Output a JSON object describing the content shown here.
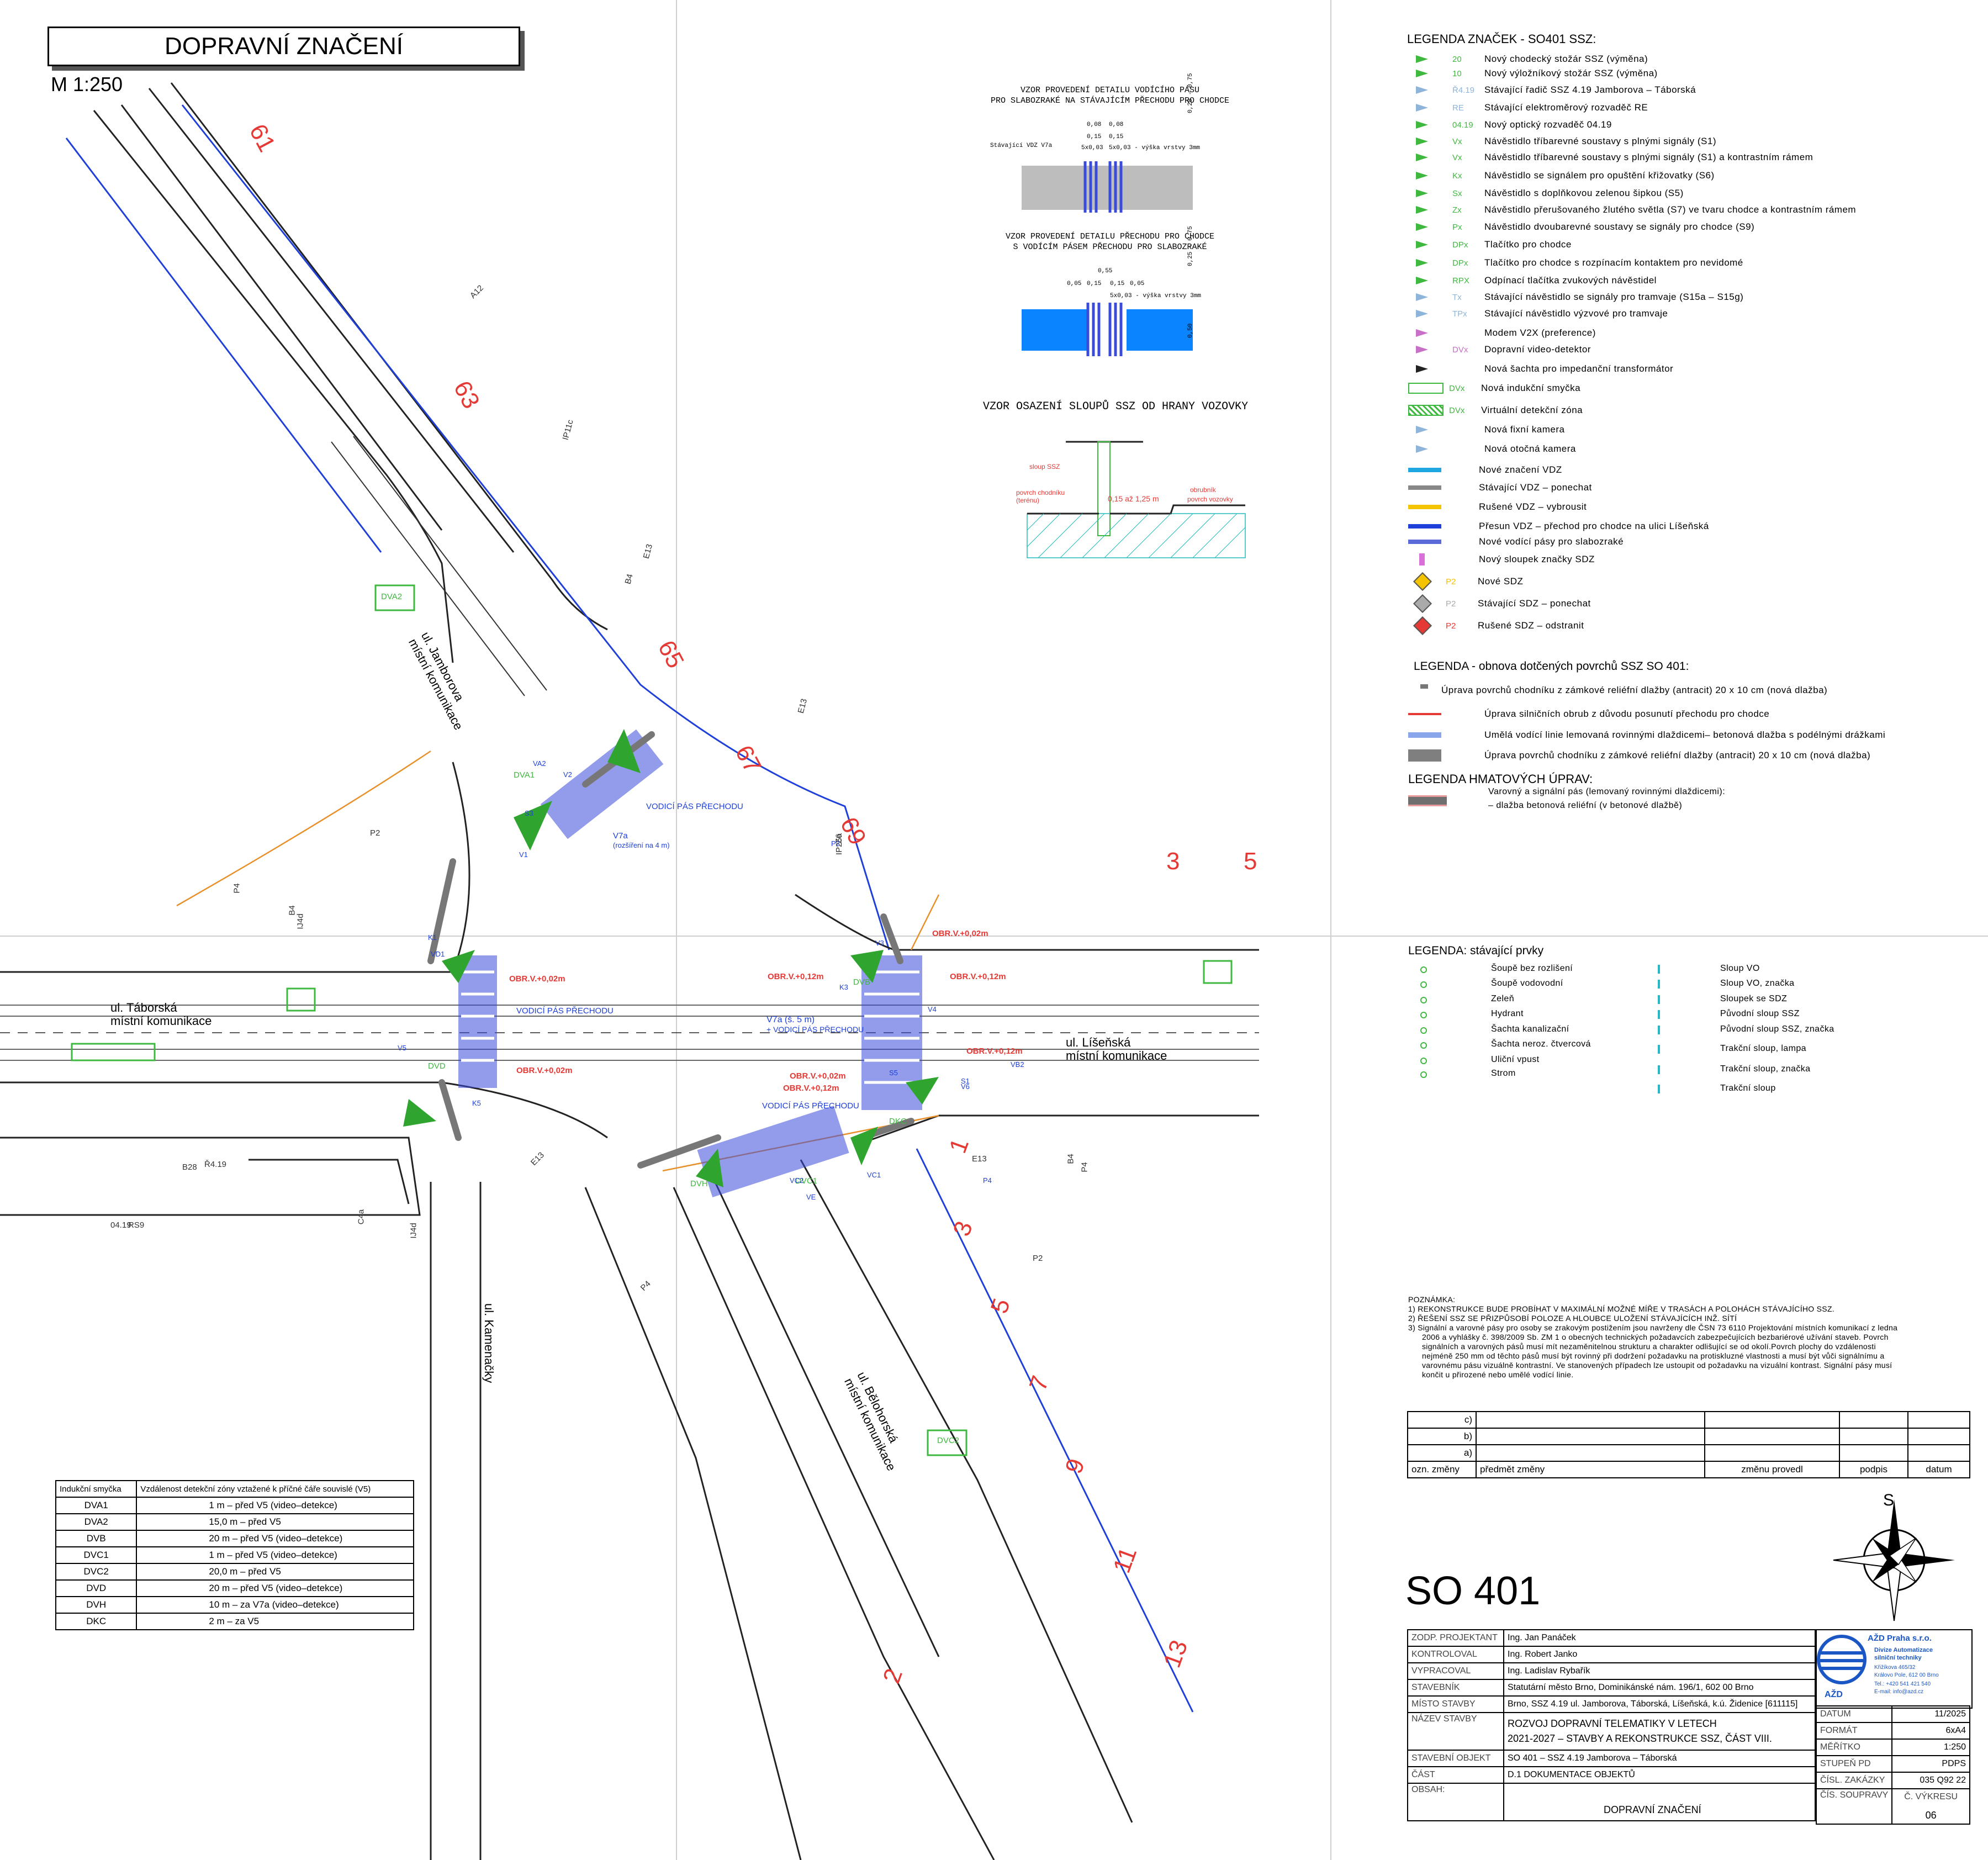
{
  "header": {
    "title": "DOPRAVNÍ ZNAČENÍ",
    "scale": "M 1:250"
  },
  "details": {
    "d1_title_1": "VZOR PROVEDENÍ DETAILU VODÍCÍHO PÁSU",
    "d1_title_2": "PRO SLABOZRAKÉ NA STÁVAJÍCÍM PŘECHODU PRO CHODCE",
    "d1_label": "Stávající VDZ V7a",
    "d1_dim1": "0,08",
    "d1_dim2": "0,15",
    "d1_dim3": "5x0,03",
    "d1_dim4": "5x0,03 - výška vrstvy 3mm",
    "d1_dim5": "0,25 - 0,75",
    "d2_title_1": "VZOR PROVEDENÍ DETAILU PŘECHODU PRO CHODCE",
    "d2_title_2": "S VODÍCÍM PÁSEM PŘECHODU PRO SLABOZRAKÉ",
    "d2_dim1": "0,55",
    "d2_dim2": "0,05",
    "d2_dim3": "0,15",
    "d2_dim4": "5x0,03 - výška vrstvy 3mm",
    "d2_dim5": "0,25 - 0,75",
    "d2_dim6": "0,50",
    "d3_title": "VZOR OSAZENÍ SLOUPŮ SSZ OD HRANY VOZOVKY",
    "d3_l1": "sloup SSZ",
    "d3_l2": "povrch chodníku (terénu)",
    "d3_l3": "0,15 až 1,25 m",
    "d3_l4": "obrubník",
    "d3_l5": "povrch vozovky"
  },
  "legend_ssz": {
    "title": "LEGENDA ZNAČEK -  SO401 SSZ:",
    "items": [
      {
        "code": "20",
        "text": "Nový chodecký stožár SSZ (výměna)",
        "color": "#3fb83f"
      },
      {
        "code": "10",
        "text": "Nový výložníkový stožár SSZ (výměna)",
        "color": "#3fb83f"
      },
      {
        "code": "Ř4.19",
        "text": "Stávající řadič SSZ 4.19 Jamborova – Táborská",
        "color": "#8fb4d9"
      },
      {
        "code": "RE",
        "text": "Stávající elektroměrový rozvaděč RE",
        "color": "#8fb4d9"
      },
      {
        "code": "04.19",
        "text": "Nový optický rozvaděč 04.19",
        "color": "#3fb83f"
      },
      {
        "code": "Vx",
        "text": "Návěstidlo tříbarevné soustavy s plnými signály (S1)",
        "color": "#3fb83f"
      },
      {
        "code": "Vx",
        "text": "Návěstidlo tříbarevné soustavy s plnými signály (S1) a kontrastním rámem",
        "color": "#3fb83f"
      },
      {
        "code": "Kx",
        "text": "Návěstidlo se signálem pro opuštění křižovatky (S6)",
        "color": "#3fb83f"
      },
      {
        "code": "Sx",
        "text": "Návěstidlo s doplňkovou zelenou šipkou (S5)",
        "color": "#3fb83f"
      },
      {
        "code": "Zx",
        "text": "Návěstidlo přerušovaného žlutého světla (S7) ve tvaru chodce a kontrastním rámem",
        "color": "#3fb83f"
      },
      {
        "code": "Px",
        "text": "Návěstidlo dvoubarevné soustavy se signály pro chodce (S9)",
        "color": "#3fb83f"
      },
      {
        "code": "DPx",
        "text": "Tlačítko pro chodce",
        "color": "#3fb83f"
      },
      {
        "code": "DPx",
        "text": "Tlačítko pro chodce s rozpínacím kontaktem pro nevidomé",
        "color": "#3fb83f"
      },
      {
        "code": "RPX",
        "text": "Odpínací tlačítka zvukových návěstidel",
        "color": "#3fb83f"
      },
      {
        "code": "Tx",
        "text": "Stávající návěstidlo se signály pro tramvaje (S15a – S15g)",
        "color": "#8fb4d9"
      },
      {
        "code": "TPx",
        "text": "Stávající návěstidlo výzvové pro tramvaje",
        "color": "#8fb4d9"
      },
      {
        "code": "",
        "text": "Modem V2X (preference)",
        "color": "#c86fc8"
      },
      {
        "code": "DVx",
        "text": "Dopravní video-detektor",
        "color": "#c86fc8"
      },
      {
        "code": "",
        "text": "Nová šachta pro impedanční transformátor",
        "color": "#222222"
      },
      {
        "code": "DVx",
        "text": "Nová indukční smyčka",
        "color": "#3fb83f"
      },
      {
        "code": "DVx",
        "text": "Virtuální detekční zóna",
        "color": "#3fb83f"
      },
      {
        "code": "",
        "text": "Nová fixní kamera",
        "color": "#8fb4d9"
      },
      {
        "code": "",
        "text": "Nová otočná kamera",
        "color": "#8fb4d9"
      },
      {
        "code": "",
        "text": "Nové značení VDZ",
        "color": "#1ea7e1"
      },
      {
        "code": "",
        "text": "Stávající VDZ – ponechat",
        "color": "#888888"
      },
      {
        "code": "",
        "text": "Rušené VDZ – vybrousit",
        "color": "#f5c400"
      },
      {
        "code": "",
        "text": "Přesun VDZ – přechod pro chodce na ulici Líšeňská",
        "color": "#1e40d9"
      },
      {
        "code": "",
        "text": "Nové vodící pásy pro slabozraké",
        "color": "#5a6bd9"
      },
      {
        "code": "",
        "text": "Nový sloupek značky SDZ",
        "color": "#d96fd9"
      },
      {
        "code": "P2",
        "text": "Nové SDZ",
        "color": "#f5c400"
      },
      {
        "code": "P2",
        "text": "Stávající SDZ – ponechat",
        "color": "#aaaaaa"
      },
      {
        "code": "P2",
        "text": "Rušené SDZ – odstranit",
        "color": "#e53935"
      }
    ]
  },
  "legend_surface": {
    "title": "LEGENDA - obnova dotčených povrchů SSZ SO 401:",
    "items": [
      "Úprava povrchů chodníku z zámkové reliéfní dlažby  (antracit) 20 x 10 cm (nová dlažba)",
      "Úprava silničních obrub z důvodu posunutí přechodu pro chodce",
      "Umělá vodící linie lemovaná rovinnými dlaždicemi– betonová dlažba s podélnými drážkami",
      "Úprava povrchů chodníku z zámkové reliéfní dlažby  (antracit) 20 x 10 cm (nová dlažba)"
    ]
  },
  "legend_tactile": {
    "title": "LEGENDA HMATOVÝCH ÚPRAV:",
    "line1": "Varovný a signální pás (lemovaný rovinnými dlaždicemi):",
    "line2": "– dlažba betonová reliéfní (v betonové dlažbě)"
  },
  "legend_existing": {
    "title": "LEGENDA: stávající prvky",
    "left": [
      "Šoupě bez rozlišení",
      "Šoupě vodovodní",
      "Zeleň",
      "Hydrant",
      "Šachta kanalizační",
      "Šachta neroz. čtvercová",
      "Uliční vpust",
      "Strom"
    ],
    "right": [
      "Sloup VO",
      "Sloup VO, značka",
      "Sloupek se SDZ",
      "Původní sloup SSZ",
      "Původní sloup SSZ, značka",
      "Trakční sloup, lampa",
      "Trakční sloup, značka",
      "Trakční sloup"
    ]
  },
  "notes": {
    "title": "POZNÁMKA:",
    "n1": "1)   REKONSTRUKCE BUDE PROBÍHAT V MAXIMÁLNÍ MOŽNÉ MÍŘE V TRASÁCH A POLOHÁCH STÁVAJÍCÍHO SSZ.",
    "n2": "2)   ŘEŠENÍ SSZ SE PŘIZPŮSOBÍ POLOZE A HLOUBCE  ULOŽENÍ STÁVAJÍCÍCH INŽ. SÍTÍ",
    "n3a": "3)   Signální a varovné pásy pro osoby se zrakovým postižením jsou navrženy dle ČSN 73 6110 Projektování místních komunikací z ledna",
    "n3b": "2006 a vyhlášky č. 398/2009 Sb. ZM 1 o obecných technických požadavcích zabezpečujících bezbariérové užívání staveb. Povrch",
    "n3c": "signálních a varovných pásů musí mít nezaměnitelnou   strukturu a charakter odlišující se od okolí.Povrch plochy do   vzdálenosti",
    "n3d": "nejméně 250 mm od těchto pásů musí být rovinný při dodržení požadavku na protiskluzné vlastnosti a musí být vůči signálnímu a",
    "n3e": "varovnému pásu vizuálně kontrastní. Ve stanovených případech lze ustoupit od požadavku na vizuální kontrast. Signální pásy musí",
    "n3f": "končit u přirozené nebo umělé vodící linie."
  },
  "changes": {
    "rows": [
      "c)",
      "b)",
      "a)"
    ],
    "h1": "ozn. změny",
    "h2": "předmět změny",
    "h3": "změnu provedl",
    "h4": "podpis",
    "h5": "datum"
  },
  "object_code": "SO 401",
  "compass_label": "S",
  "title_block": {
    "r1l": "ZODP. PROJEKTANT",
    "r1v": "Ing. Jan Panáček",
    "r2l": "KONTROLOVAL",
    "r2v": "Ing. Robert Janko",
    "r3l": "VYPRACOVAL",
    "r3v": "Ing. Ladislav Rybařík",
    "r4l": "STAVEBNÍK",
    "r4v": "Statutární město Brno, Dominikánské nám. 196/1, 602 00 Brno",
    "r5l": "MÍSTO STAVBY",
    "r5v": "Brno, SSZ 4.19 ul. Jamborova, Táborská, Líšeňská, k.ú. Židenice [611115]",
    "r6l": "NÁZEV STAVBY",
    "r6v1": "ROZVOJ DOPRAVNÍ TELEMATIKY V LETECH",
    "r6v2": "2021-2027 – STAVBY A REKONSTRUKCE SSZ, ČÁST VIII.",
    "r7l": "STAVEBNÍ OBJEKT",
    "r7v": "SO 401 – SSZ 4.19 Jamborova – Táborská",
    "r8l": "ČÁST",
    "r8v": "D.1 DOKUMENTACE OBJEKTŮ",
    "r9l": "OBSAH:",
    "r9v": "DOPRAVNÍ ZNAČENÍ",
    "company": "AŽD Praha s.r.o.",
    "division1": "Divize Automatizace",
    "division2": "silniční techniky",
    "addr1": "Křižíkova 465/32",
    "addr2": "Královo Pole, 612 00 Brno",
    "phone": "Tel.: +420 541 421 540",
    "email": "E-mail: info@azd.cz",
    "logo": "AŽD",
    "k1": "DATUM",
    "v1": "11/2025",
    "k2": "FORMÁT",
    "v2": "6xA4",
    "k3": "MĚŘÍTKO",
    "v3": "1:250",
    "k4": "STUPEŇ PD",
    "v4": "PDPS",
    "k5": "ČÍSL. ZAKÁZKY",
    "v5": "035 Q92 22",
    "k6": "ČÍS. SOUPRAVY",
    "k6b": "Č. VÝKRESU",
    "v6": "06"
  },
  "loops": {
    "h1": "Indukční smyčka",
    "h2": "Vzdálenost detekční zóny vztažené k příčné čáře souvislé (V5)",
    "rows": [
      [
        "DVA1",
        "1 m  –  před V5 (video–detekce)"
      ],
      [
        "DVA2",
        "15,0 m  –  před V5"
      ],
      [
        "DVB",
        "20 m  –  před V5 (video–detekce)"
      ],
      [
        "DVC1",
        "1 m  –  před V5 (video–detekce)"
      ],
      [
        "DVC2",
        "20,0 m  –  před V5"
      ],
      [
        "DVD",
        "20 m  –  před V5 (video–detekce)"
      ],
      [
        "DVH",
        "10 m  –  za V7a (video–detekce)"
      ],
      [
        "DKC",
        "2 m  –  za V5"
      ]
    ]
  },
  "map": {
    "st_jamborova": "ul. Jamborova",
    "st_jamborova_sub": "místní komunikace",
    "st_taborska": "ul. Táborská",
    "st_taborska_sub": "místní komunikace",
    "st_lisenska": "ul. Líšeňská",
    "st_lisenska_sub": "místní komunikace",
    "st_kamenacky": "ul. Kamenačky",
    "st_belohorska": "ul. Bělohorská",
    "st_belohorska_sub": "místní komunikace",
    "vodici": "VODICÍ PÁS PŘECHODU",
    "v7a": "V7a",
    "v7a_sub": "(rozšíření na 4 m)",
    "v7a2": "V7a (š. 5 m)",
    "v7a2_sub": "+ VODICÍ PÁS PŘECHODU",
    "obr": "OBR.V.+0,02m",
    "obr2": "OBR.V.+0,12m",
    "numbers": [
      "61",
      "63",
      "65",
      "67",
      "69",
      "3",
      "5",
      "1",
      "3",
      "5",
      "7",
      "9",
      "11",
      "13",
      "2"
    ],
    "signs": [
      "A12",
      "IP11c",
      "E13",
      "B4",
      "E13",
      "IP25a",
      "P2",
      "P4",
      "B4",
      "IJ4d",
      "E13",
      "P4",
      "B4",
      "E13",
      "C4a",
      "IJ4d",
      "P2",
      "P4",
      "B28",
      "Ř4.19",
      "04.19",
      "RS9",
      "Z6"
    ],
    "dets": [
      "DVA2",
      "DVA1",
      "DVB",
      "DVC1",
      "DVC2",
      "DVD",
      "DKC",
      "DVH"
    ],
    "sig": [
      "V1",
      "V2",
      "V3",
      "V4",
      "V5",
      "V6",
      "VA2",
      "VB2",
      "VC1",
      "VC2",
      "VD1",
      "VE",
      "K1",
      "K3",
      "K5",
      "S1",
      "S3",
      "S5",
      "P2",
      "P4"
    ]
  }
}
